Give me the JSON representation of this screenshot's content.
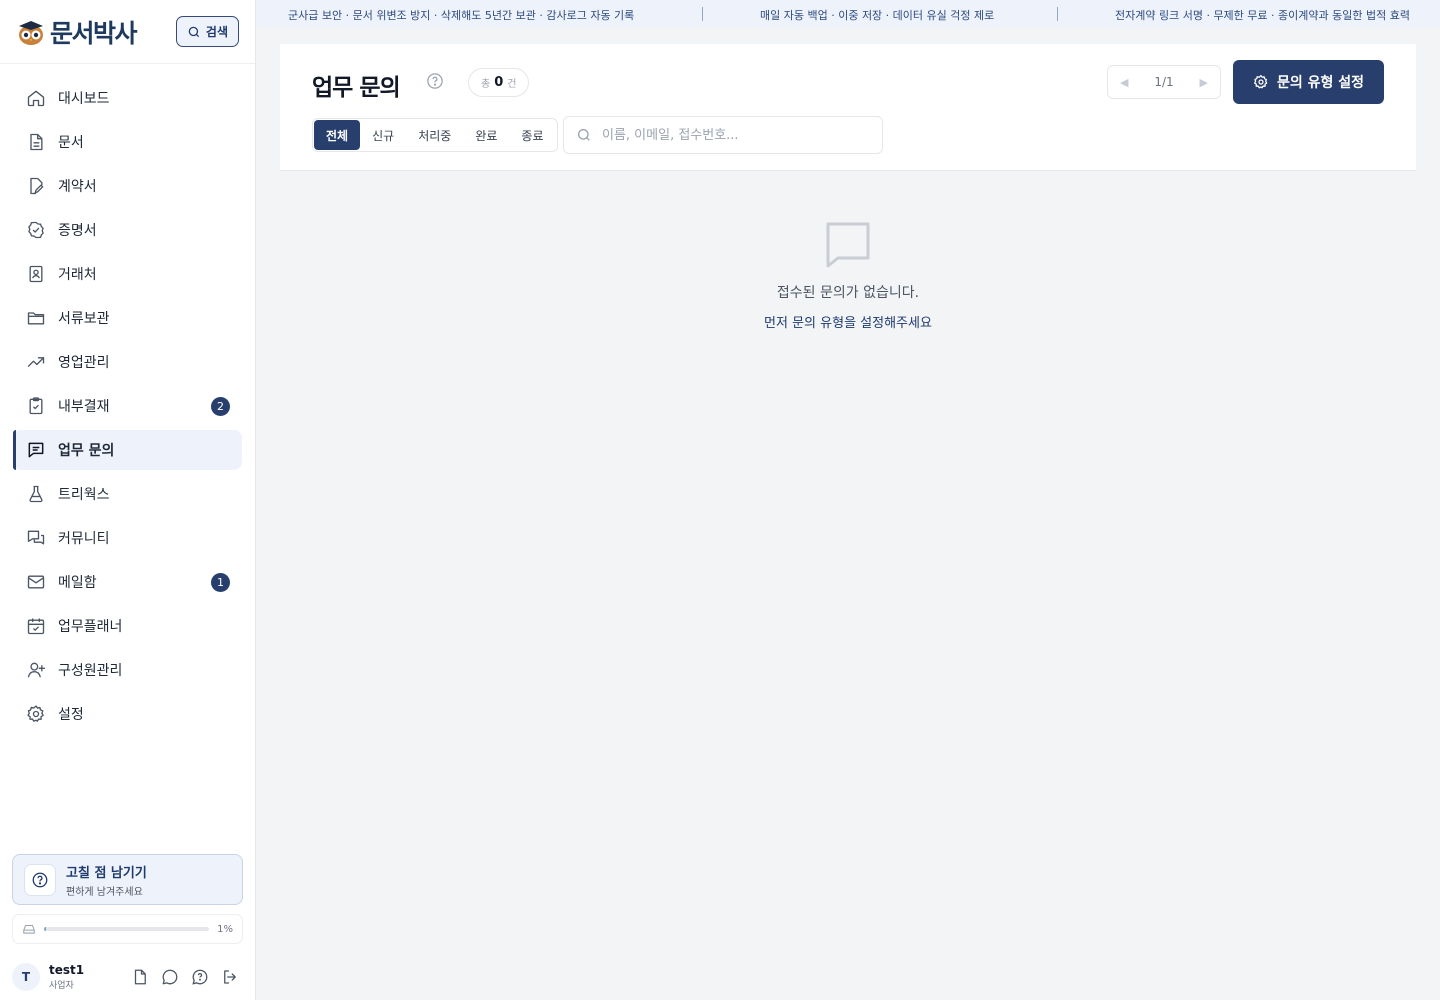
{
  "app": {
    "logo_text": "문서박사",
    "search_label": "검색"
  },
  "banner": {
    "items": [
      "군사급 보안 · 문서 위변조 방지 · 삭제해도 5년간 보관 · 감사로그 자동 기록",
      "매일 자동 백업 · 이중 저장 · 데이터 유실 걱정 제로",
      "전자계약 링크 서명 · 무제한 무료 · 종이계약과 동일한 법적 효력"
    ]
  },
  "sidebar": {
    "items": [
      {
        "label": "대시보드",
        "icon": "home-icon"
      },
      {
        "label": "문서",
        "icon": "document-icon"
      },
      {
        "label": "계약서",
        "icon": "contract-edit-icon"
      },
      {
        "label": "증명서",
        "icon": "certificate-check-icon"
      },
      {
        "label": "거래처",
        "icon": "contact-card-icon"
      },
      {
        "label": "서류보관",
        "icon": "folder-icon"
      },
      {
        "label": "영업관리",
        "icon": "trending-up-icon"
      },
      {
        "label": "내부결재",
        "icon": "clipboard-check-icon",
        "badge": "2"
      },
      {
        "label": "업무 문의",
        "icon": "message-square-icon",
        "active": true
      },
      {
        "label": "트리웍스",
        "icon": "flask-icon"
      },
      {
        "label": "커뮤니티",
        "icon": "chat-bubbles-icon"
      },
      {
        "label": "메일함",
        "icon": "mail-icon",
        "badge": "1"
      },
      {
        "label": "업무플래너",
        "icon": "calendar-check-icon"
      },
      {
        "label": "구성원관리",
        "icon": "user-plus-icon"
      },
      {
        "label": "설정",
        "icon": "gear-icon"
      }
    ],
    "feedback": {
      "title": "고칠 점 남기기",
      "subtitle": "편하게 남겨주세요"
    },
    "storage": {
      "percent_label": "1%",
      "fraction": 0.01
    },
    "user": {
      "initial": "T",
      "name": "test1",
      "role": "사업자"
    }
  },
  "main": {
    "title": "업무 문의",
    "count": {
      "prefix": "총",
      "value": "0",
      "suffix": "건"
    },
    "pager": {
      "label": "1/1"
    },
    "settings_button": "문의 유형 설정",
    "tabs": [
      {
        "label": "전체",
        "active": true
      },
      {
        "label": "신규"
      },
      {
        "label": "처리중"
      },
      {
        "label": "완료"
      },
      {
        "label": "종료"
      }
    ],
    "search": {
      "placeholder": "이름, 이메일, 접수번호..."
    },
    "empty": {
      "title": "접수된 문의가 없습니다.",
      "link": "먼저 문의 유형을 설정해주세요"
    }
  },
  "colors": {
    "accent": "#283f6e",
    "accent_light": "#eef2fb"
  }
}
